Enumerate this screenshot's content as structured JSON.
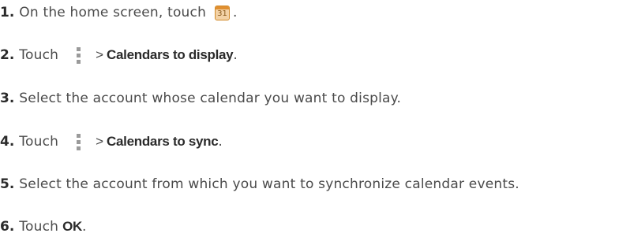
{
  "steps": [
    {
      "num": "1.",
      "text": "On the home screen, touch",
      "after": "."
    },
    {
      "num": "2.",
      "text": "Touch",
      "sep": ">",
      "bold": "Calendars to display",
      "after": "."
    },
    {
      "num": "3.",
      "text": "Select the account whose calendar you want to display."
    },
    {
      "num": "4.",
      "text": "Touch",
      "sep": ">",
      "bold": "Calendars to sync",
      "after": "."
    },
    {
      "num": "5.",
      "text": "Select the account from which you want to synchronize calendar events."
    },
    {
      "num": "6.",
      "text": "Touch",
      "bold": "OK",
      "after": "."
    }
  ],
  "icons": {
    "calendar_day": "31",
    "calendar": "calendar-icon",
    "menu": "menu-icon"
  },
  "colors": {
    "text": "#4a4a4a",
    "number": "#2b2b2b",
    "calendar_accent": "#e08f31"
  }
}
